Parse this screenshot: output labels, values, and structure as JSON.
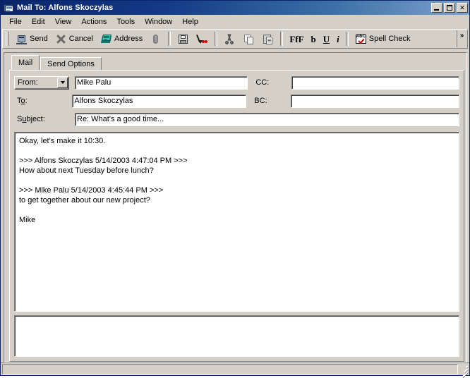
{
  "window": {
    "title": "Mail To: Alfons Skoczylas",
    "icon": "mail-envelope-icon",
    "controls": {
      "minimize": "minimize-button",
      "maximize": "maximize-button",
      "close_label": "✕"
    }
  },
  "menu": {
    "items": [
      {
        "label": "File"
      },
      {
        "label": "Edit"
      },
      {
        "label": "View"
      },
      {
        "label": "Actions"
      },
      {
        "label": "Tools"
      },
      {
        "label": "Window"
      },
      {
        "label": "Help"
      }
    ]
  },
  "toolbar": {
    "send_label": "Send",
    "cancel_label": "Cancel",
    "address_label": "Address",
    "attach_icon": "paperclip-icon",
    "save_icon": "floppy-save-icon",
    "save_as_icon": "save-as-icon",
    "cut_icon": "scissors-cut-icon",
    "copy_icon": "copy-icon",
    "paste_icon": "paste-icon",
    "font_glyph": "FfF",
    "bold_glyph": "b",
    "underline_glyph": "U",
    "italic_glyph": "i",
    "spell_check_label": "Spell Check",
    "spell_icon_text": "ABC",
    "overflow_glyph": "»"
  },
  "tabs": [
    {
      "label": "Mail",
      "active": true
    },
    {
      "label": "Send Options",
      "active": false
    }
  ],
  "form": {
    "from_label": "From:",
    "from_value": "Mike Palu",
    "cc_label": "CC:",
    "cc_value": "",
    "to_label_pre": "T",
    "to_label_acc": "o",
    "to_label_post": ":",
    "to_value": "Alfons Skoczylas",
    "bc_label": "BC:",
    "bc_value": "",
    "subject_label_pre": "S",
    "subject_label_acc": "u",
    "subject_label_post": "bject:",
    "subject_value": "Re: What's a good time..."
  },
  "message": {
    "body": "Okay, let's make it 10:30.\n\n>>> Alfons Skoczylas 5/14/2003 4:47:04 PM >>>\nHow about next Tuesday before lunch?\n\n>>> Mike Palu 5/14/2003 4:45:44 PM >>>\nto get together about our new project?\n\nMike"
  },
  "attachments": {
    "items": []
  },
  "statusbar": {
    "text": ""
  },
  "colors": {
    "titlebar_start": "#0a246a",
    "titlebar_end": "#7ea2cf",
    "window_face": "#d4d0c8",
    "field_bg": "#ffffff",
    "text": "#000000"
  }
}
